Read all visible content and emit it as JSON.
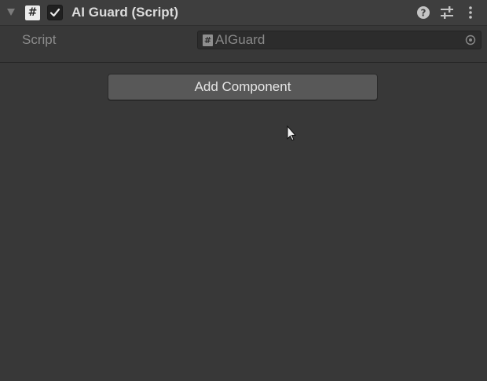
{
  "component": {
    "title": "AI Guard (Script)",
    "enabled": true,
    "script_badge": "#"
  },
  "header_icons": [
    "help-icon",
    "preset-icon",
    "context-menu-icon"
  ],
  "script_field": {
    "label": "Script",
    "icon_glyph": "#",
    "value": "AIGuard"
  },
  "add_component": {
    "label": "Add Component"
  },
  "colors": {
    "background": "#383838",
    "header": "#3e3e3e",
    "field": "#2c2c2c",
    "button": "#585858",
    "text": "#dcdcdc",
    "muted_text": "#8c8c8c"
  }
}
